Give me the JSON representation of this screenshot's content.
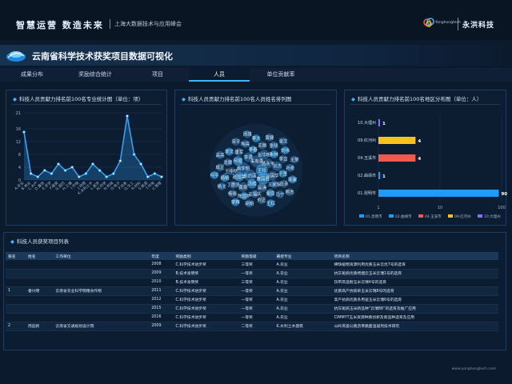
{
  "header": {
    "brand_main": "智慧运营  数造未来",
    "brand_sub": "上海大数据技术与应用峰会",
    "logo_en": "Yonghongtech",
    "logo_cn": "永洪科技"
  },
  "app": {
    "title": "云南省科学技术获奖项目数据可视化"
  },
  "tabs": [
    {
      "label": "成果分布"
    },
    {
      "label": "奖励综合统计"
    },
    {
      "label": "项目"
    },
    {
      "label": "人员"
    },
    {
      "label": "单位贡献率"
    }
  ],
  "active_tab": "人员",
  "colors": {
    "accent": "#3db4ff",
    "line": "#35a6ff",
    "yellow": "#f7c31b",
    "red": "#f05a4e",
    "blue": "#1e9bff",
    "purple": "#8a6cff"
  },
  "panels": {
    "line_chart_title": "科技人员贡献力排名前100名专业统计图（单位：项）",
    "word_cloud_title": "科技人员贡献力排名前100名人员姓名排列图",
    "region_chart_title": "科技人员贡献力排名前100名地区分布图（单位：人）",
    "table_title": "科技人员获奖项目列表"
  },
  "chart_data": [
    {
      "type": "line",
      "ylim": [
        0,
        21
      ],
      "yticks": [
        "0",
        "4",
        "8",
        "12",
        "16",
        "21"
      ],
      "categories": [
        "A.农业",
        "B.林业",
        "C.水产",
        "D.畜牧",
        "E.农学",
        "F.植保",
        "G.园艺",
        "H.土壤",
        "I.作物",
        "J.地理",
        "K.水利土木",
        "L.医学",
        "M.药学",
        "N.机械",
        "O.电子",
        "P.信息",
        "Q.化工",
        "R.材料",
        "S.能源",
        "T.环境",
        "U.管理"
      ],
      "values": [
        15,
        2,
        1,
        3,
        2,
        5,
        3,
        4,
        1,
        2,
        5,
        3,
        1,
        2,
        6,
        20,
        8,
        5,
        1,
        2,
        1
      ]
    },
    {
      "type": "bar",
      "orientation": "horizontal",
      "categories": [
        "10.大理州",
        "09.红河州",
        "04.玉溪市",
        "02.曲靖市",
        "01.昆明市"
      ],
      "values": [
        1,
        4,
        4,
        1,
        90
      ],
      "bar_colors": [
        "#8a6cff",
        "#f7c31b",
        "#f05a4e",
        "#1e9bff",
        "#1e9bff"
      ],
      "xticks": [
        "1",
        "10",
        "100"
      ],
      "xscale": "log",
      "legend": [
        "01.昆明市",
        "02.曲靖市",
        "04.玉溪市",
        "09.红河州",
        "10.大理州"
      ],
      "legend_colors": [
        "#1e9bff",
        "#1e9bff",
        "#f05a4e",
        "#f7c31b",
        "#8a6cff"
      ]
    }
  ],
  "word_cloud": [
    "王玲",
    "张启国",
    "朱有勇",
    "唐国胜",
    "南李明",
    "杨永平",
    "汤维",
    "李勇",
    "马国华",
    "赵国荣",
    "张华明",
    "吴涛",
    "何霞",
    "刘杰",
    "黄泉",
    "李春",
    "王家银",
    "王中华",
    "朱林",
    "王福庆",
    "唐军",
    "于坚",
    "丁惠坚",
    "王丽",
    "张应",
    "龙顺",
    "李云",
    "陈国华",
    "陶亮",
    "王永",
    "杨明",
    "张晓",
    "刘正",
    "李文",
    "孙奇",
    "杨晓",
    "李大",
    "马宁",
    "成正",
    "刘伟",
    "胡明",
    "宋平",
    "陈家",
    "杨文",
    "黄健",
    "王红",
    "高亮",
    "王荣",
    "李辉",
    "周雄",
    "熊杰",
    "何平",
    "张文"
  ],
  "table": {
    "headers": [
      "排名",
      "姓名",
      "工作单位",
      "年度",
      "奖励类别",
      "奖励等级",
      "著授专业",
      "项目名称"
    ],
    "rows": [
      [
        "",
        "",
        "",
        "2008",
        "C.科学技术进步奖",
        "三等奖",
        "A.农业",
        "稀缺植物资源利用优质玉米云优7号的选育"
      ],
      [
        "",
        "",
        "",
        "2009",
        "B.技术发明奖",
        "一等奖",
        "A.农业",
        "抗灰斑病优质烤烟云玉米云瑞1号的选育"
      ],
      [
        "",
        "",
        "",
        "2010",
        "B.技术发明奖",
        "三等奖",
        "A.农业",
        "热带高温耐玉米云瑞4号的选育"
      ],
      [
        "1",
        "番兴明",
        "云南省农业科学院粮食作物",
        "2011",
        "C.科学技术进步奖",
        "一等奖",
        "A.农业",
        "优质高产抗病单玉米云瑞8号的选育"
      ],
      [
        "",
        "",
        "",
        "2012",
        "C.科学技术进步奖",
        "一等奖",
        "A.农业",
        "高产抗病优质多用途玉米云瑞6号的选育"
      ],
      [
        "",
        "",
        "",
        "2015",
        "C.科学技术进步奖",
        "一等奖",
        "A.农业",
        "抗灰斑病玉米新品种“云瑞88”的选育及推广应用"
      ],
      [
        "",
        "",
        "",
        "2016",
        "C.科学技术进步奖",
        "一等奖",
        "A.农业",
        "CIMMYT玉米资源种质创新及新品种选育及应用"
      ],
      [
        "2",
        "周迎新",
        "云南省交通规划设计院",
        "2009",
        "C.科学技术进步奖",
        "二等奖",
        "K.水利土木建筑",
        "山岭高速公路沥青路面温凝剂技术研究"
      ]
    ]
  },
  "footer": {
    "url": "www.yonghongtech.com"
  }
}
